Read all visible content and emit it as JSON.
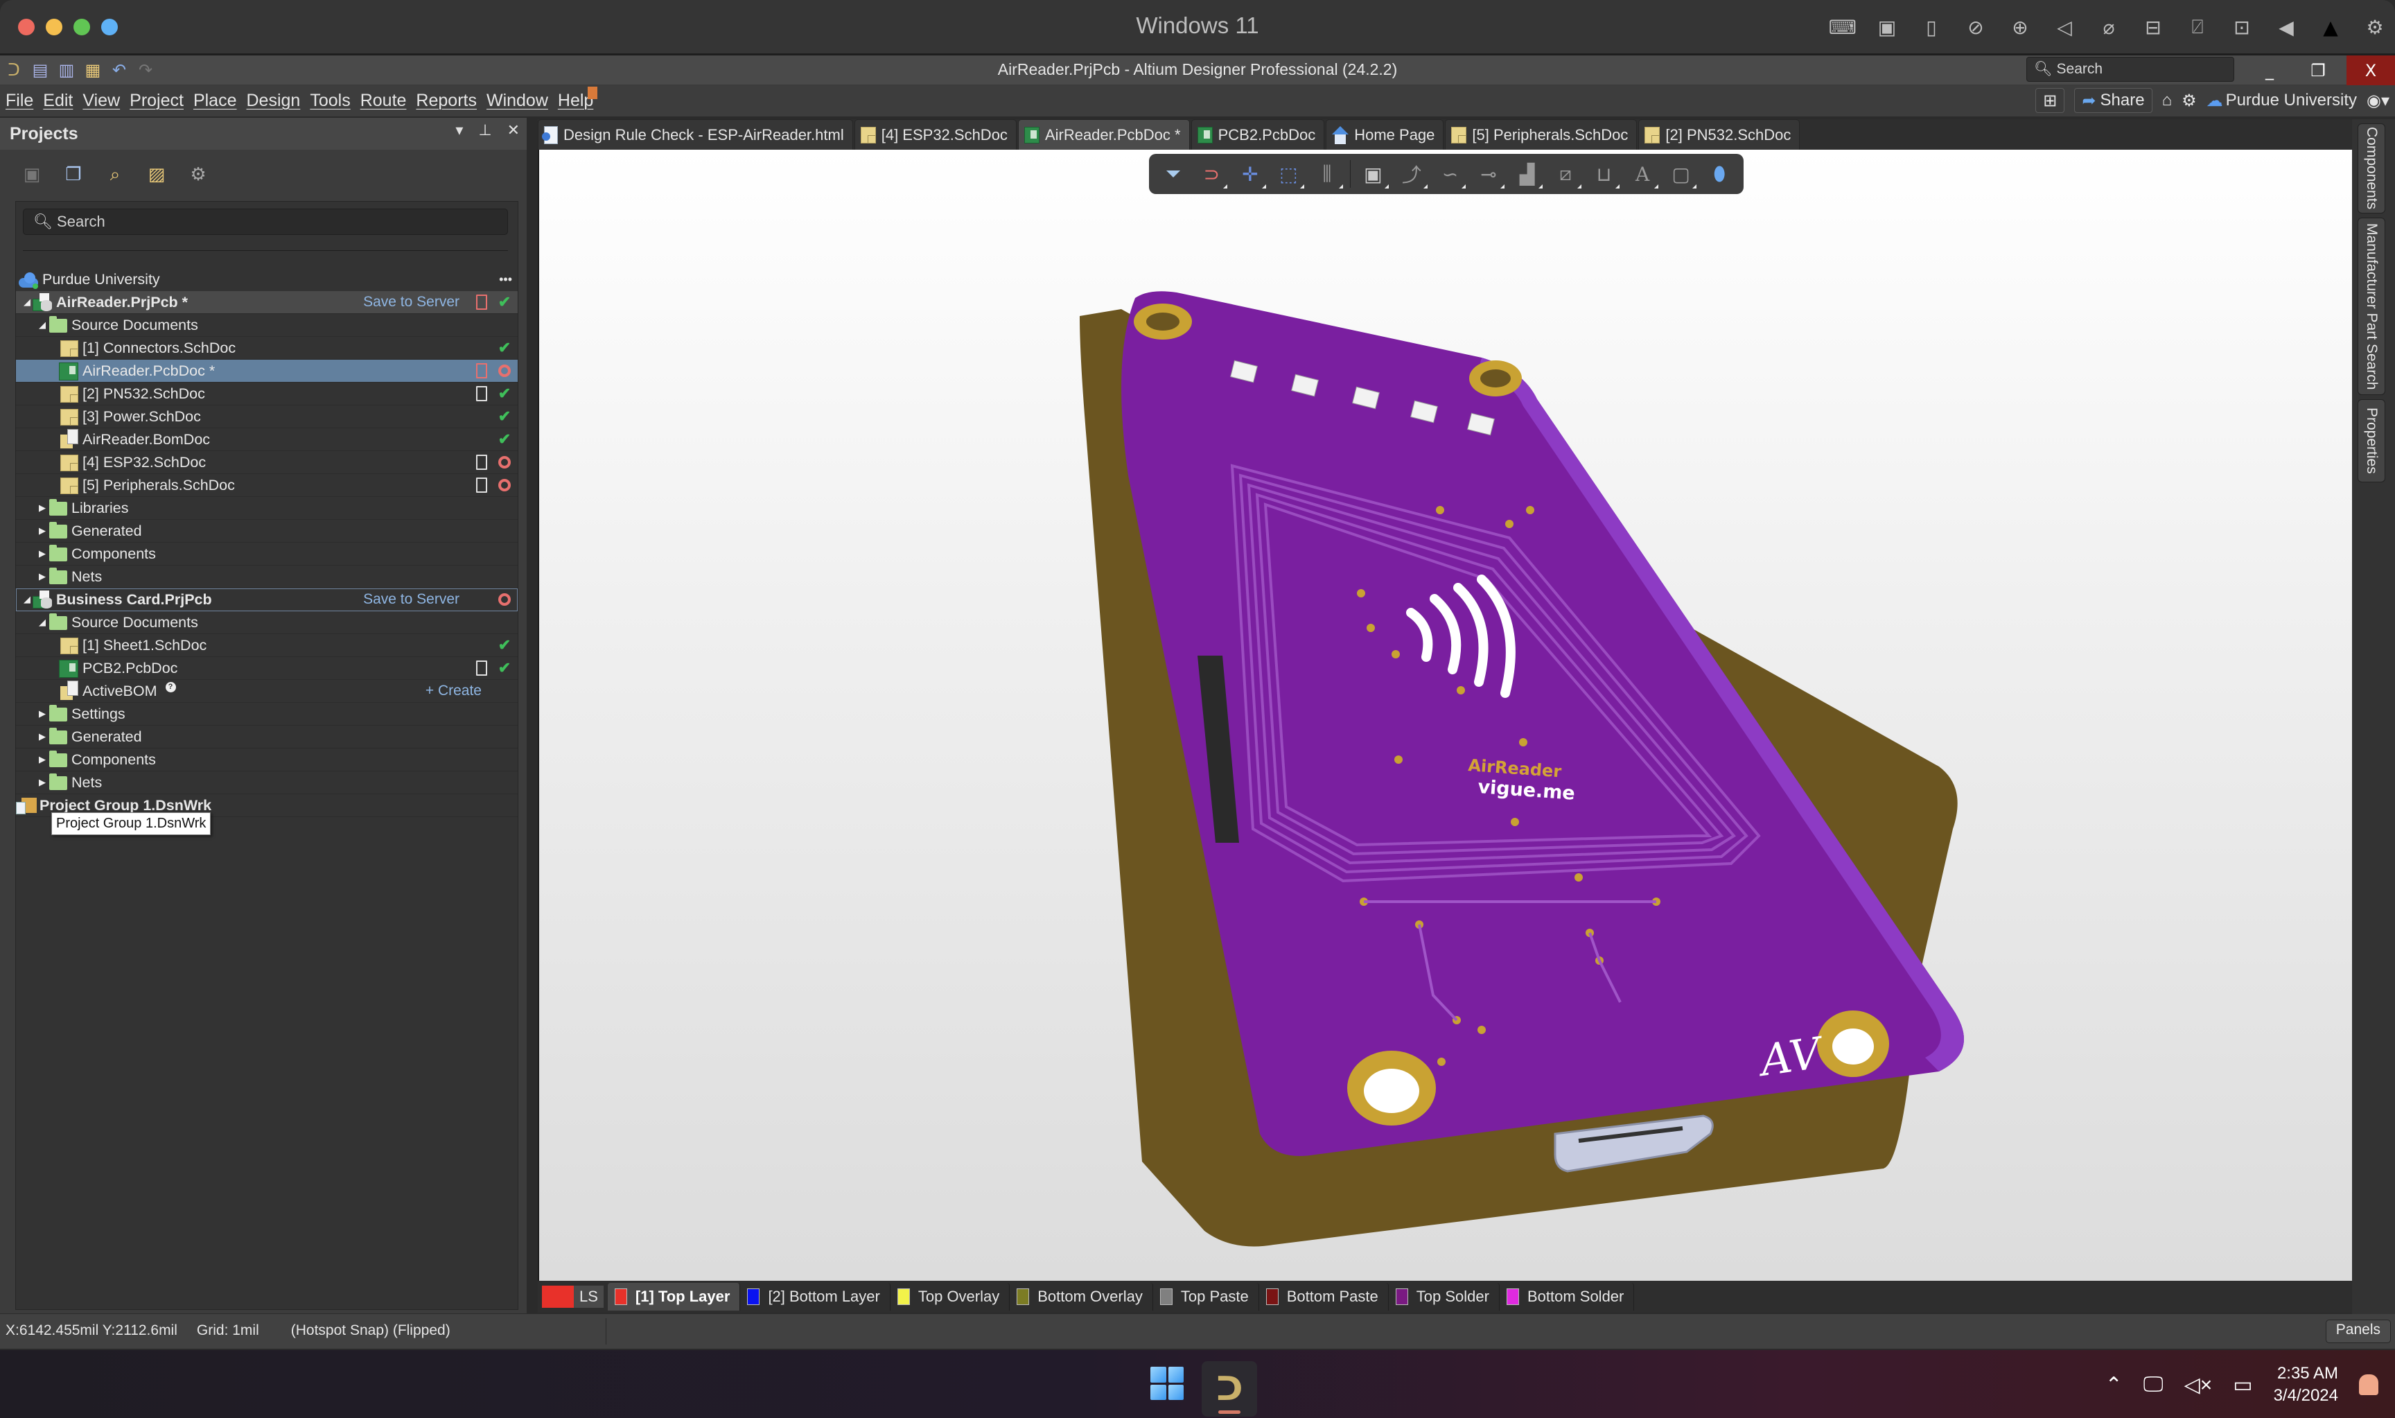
{
  "os": {
    "window_title": "Windows 11",
    "traffic_lights": [
      "#ee6a5f",
      "#f5bf4f",
      "#61c554",
      "#5fb1f5"
    ],
    "status_icons": [
      "keyboard-icon",
      "chip-icon",
      "usb-icon",
      "network-off-icon",
      "globe-icon",
      "speaker-icon",
      "mic-off-icon",
      "drive-icon",
      "camera-off-icon",
      "folder-share-icon",
      "arrow-left-icon",
      "warning-icon",
      "gear-icon"
    ]
  },
  "app": {
    "title": "AirReader.PrjPcb - Altium Designer Professional (24.2.2)",
    "search_placeholder": "Search",
    "window_controls": {
      "minimize": "_",
      "restore": "❐",
      "close": "X"
    }
  },
  "menu": {
    "items": [
      "File",
      "Edit",
      "View",
      "Project",
      "Place",
      "Design",
      "Tools",
      "Route",
      "Reports",
      "Window",
      "Help"
    ],
    "share_label": "Share",
    "workspace": "Purdue University"
  },
  "projects_panel": {
    "title": "Projects",
    "search_placeholder": "Search",
    "workspace": "Purdue University",
    "more": "•••",
    "tree": [
      {
        "label": "AirReader.PrjPcb *",
        "level": 0,
        "type": "project",
        "action": "Save to Server",
        "doc": "red",
        "status": "check",
        "expanded": true,
        "highlight": true
      },
      {
        "label": "Source Documents",
        "level": 1,
        "type": "folder",
        "expanded": true
      },
      {
        "label": "[1] Connectors.SchDoc",
        "level": 2,
        "type": "sch",
        "status": "check"
      },
      {
        "label": "AirReader.PcbDoc *",
        "level": 2,
        "type": "pcb",
        "doc": "red",
        "status": "circle",
        "selected": true
      },
      {
        "label": "[2] PN532.SchDoc",
        "level": 2,
        "type": "sch",
        "doc": "white",
        "status": "check"
      },
      {
        "label": "[3] Power.SchDoc",
        "level": 2,
        "type": "sch",
        "status": "check"
      },
      {
        "label": "AirReader.BomDoc",
        "level": 2,
        "type": "bom",
        "status": "check"
      },
      {
        "label": "[4] ESP32.SchDoc",
        "level": 2,
        "type": "sch",
        "doc": "white",
        "status": "circle"
      },
      {
        "label": "[5] Peripherals.SchDoc",
        "level": 2,
        "type": "sch",
        "doc": "white",
        "status": "circle"
      },
      {
        "label": "Libraries",
        "level": 1,
        "type": "folder",
        "expanded": false
      },
      {
        "label": "Generated",
        "level": 1,
        "type": "folder",
        "expanded": false
      },
      {
        "label": "Components",
        "level": 1,
        "type": "folder",
        "expanded": false
      },
      {
        "label": "Nets",
        "level": 1,
        "type": "folder",
        "expanded": false
      },
      {
        "label": "Business Card.PrjPcb",
        "level": 0,
        "type": "project",
        "action": "Save to Server",
        "status": "circle",
        "expanded": true,
        "outline": true
      },
      {
        "label": "Source Documents",
        "level": 1,
        "type": "folder",
        "expanded": true
      },
      {
        "label": "[1] Sheet1.SchDoc",
        "level": 2,
        "type": "sch",
        "status": "check"
      },
      {
        "label": "PCB2.PcbDoc",
        "level": 2,
        "type": "pcb",
        "doc": "white",
        "status": "check"
      },
      {
        "label": "ActiveBOM",
        "level": 2,
        "type": "bom",
        "help": "?",
        "create": "+ Create"
      },
      {
        "label": "Settings",
        "level": 1,
        "type": "folder",
        "expanded": false
      },
      {
        "label": "Generated",
        "level": 1,
        "type": "folder",
        "expanded": false
      },
      {
        "label": "Components",
        "level": 1,
        "type": "folder",
        "expanded": false
      },
      {
        "label": "Nets",
        "level": 1,
        "type": "folder",
        "expanded": false
      },
      {
        "label": "Project Group 1.DsnWrk",
        "level": -1,
        "type": "workspace"
      }
    ],
    "tooltip": "Project Group 1.DsnWrk"
  },
  "doc_tabs": [
    {
      "label": "Design Rule Check - ESP-AirReader.html",
      "icon": "html"
    },
    {
      "label": "[4] ESP32.SchDoc",
      "icon": "sch"
    },
    {
      "label": "AirReader.PcbDoc *",
      "icon": "pcb",
      "active": true
    },
    {
      "label": "PCB2.PcbDoc",
      "icon": "pcb"
    },
    {
      "label": "Home Page",
      "icon": "home"
    },
    {
      "label": "[5] Peripherals.SchDoc",
      "icon": "sch"
    },
    {
      "label": "[2] PN532.SchDoc",
      "icon": "sch"
    }
  ],
  "pcb_toolbar": [
    "filter-icon",
    "snap-magnet-icon",
    "move-icon",
    "select-rect-icon",
    "align-icon",
    "component-icon",
    "route-icon",
    "interactive-diff-icon",
    "via-icon",
    "polygon-icon",
    "line-icon",
    "dimension-icon",
    "text-icon",
    "board-outline-icon",
    "3d-body-icon"
  ],
  "board": {
    "silkscreen_title": "AirReader",
    "silkscreen_url": "vigue.me",
    "signature": "AV",
    "colors": {
      "solder_mask": "#7a1fa0",
      "copper": "#c9a233",
      "edge": "#6b5520",
      "background_top": "#ffffff",
      "background_bottom": "#dcdcdc"
    }
  },
  "right_panels": [
    "Components",
    "Manufacturer Part Search",
    "Properties"
  ],
  "layer_tabs": {
    "ls": {
      "label": "LS",
      "color": "#e8312a"
    },
    "layers": [
      {
        "label": "[1] Top Layer",
        "color": "#e8312a",
        "active": true
      },
      {
        "label": "[2] Bottom Layer",
        "color": "#0a12f0"
      },
      {
        "label": "Top Overlay",
        "color": "#f2f24a"
      },
      {
        "label": "Bottom Overlay",
        "color": "#7c7c24"
      },
      {
        "label": "Top Paste",
        "color": "#808080"
      },
      {
        "label": "Bottom Paste",
        "color": "#7a1414"
      },
      {
        "label": "Top Solder",
        "color": "#7a1a82"
      },
      {
        "label": "Bottom Solder",
        "color": "#e02ae0"
      }
    ]
  },
  "status": {
    "coords": "X:6142.455mil Y:2112.6mil",
    "grid": "Grid: 1mil",
    "mode": "(Hotspot Snap) (Flipped)",
    "panels_button": "Panels"
  },
  "taskbar": {
    "time": "2:35 AM",
    "date": "3/4/2024"
  }
}
